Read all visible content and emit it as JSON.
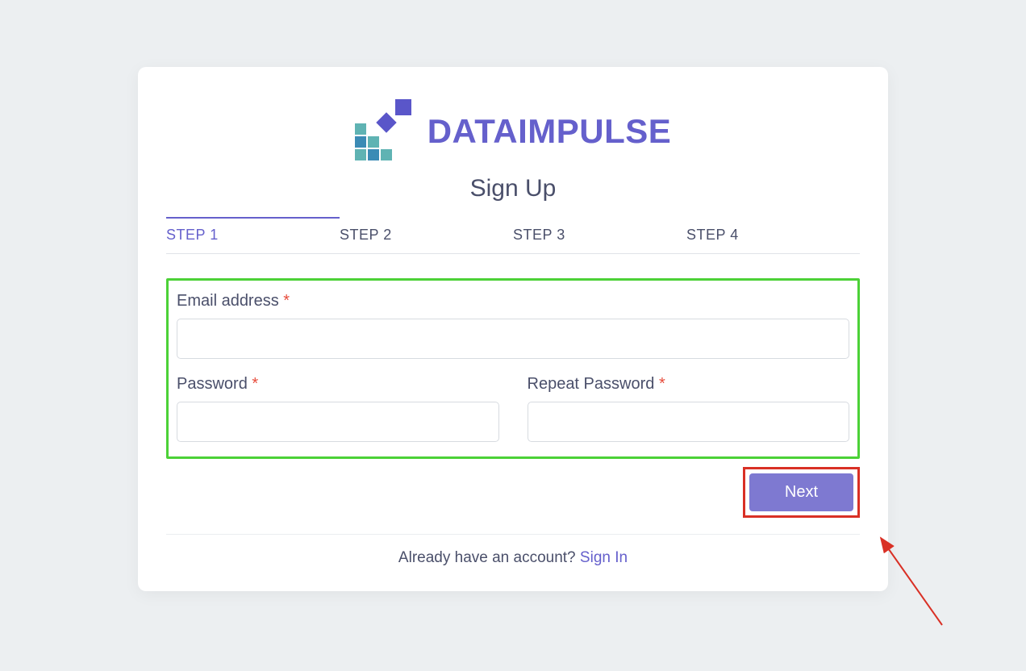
{
  "brand": {
    "name": "DATAIMPULSE"
  },
  "title": "Sign Up",
  "steps": [
    "STEP 1",
    "STEP 2",
    "STEP 3",
    "STEP 4"
  ],
  "activeStep": 0,
  "form": {
    "email": {
      "label": "Email address",
      "value": "",
      "required": true
    },
    "password": {
      "label": "Password",
      "value": "",
      "required": true
    },
    "repeatPassword": {
      "label": "Repeat Password",
      "value": "",
      "required": true
    }
  },
  "nextLabel": "Next",
  "already": {
    "text": "Already have an account? ",
    "link": "Sign In"
  },
  "requiredMark": "*",
  "colors": {
    "accent": "#6560cc",
    "highlightBox": "#4cd137",
    "callout": "#d93025"
  }
}
